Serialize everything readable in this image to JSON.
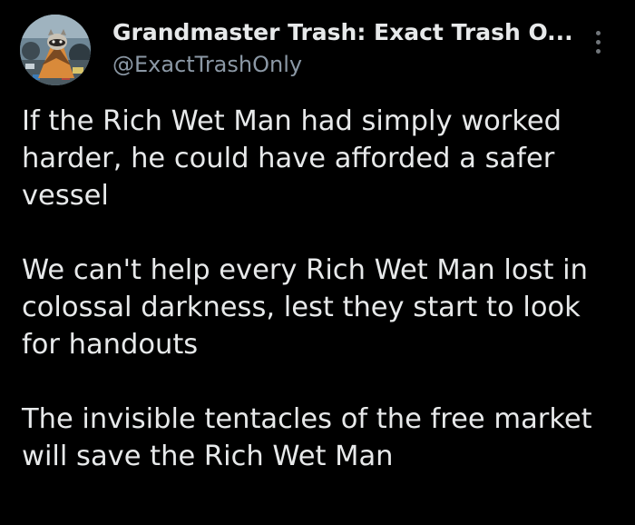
{
  "author": {
    "display_name": "Grandmaster Trash: Exact Trash O...",
    "handle": "@ExactTrashOnly",
    "avatar_icon": "raccoon-in-trash-avatar"
  },
  "menu": {
    "icon": "more-vertical-icon"
  },
  "tweet": {
    "paragraphs": [
      "If the Rich Wet Man had simply worked\nharder, he could have afforded a safer\nvessel",
      "We can't help every Rich Wet Man lost in\ncolossal darkness, lest they start to look\nfor handouts",
      "The invisible tentacles of the free market\nwill save the Rich Wet Man"
    ]
  },
  "colors": {
    "background": "#000000",
    "primary_text": "#e7e9ea",
    "secondary_text": "#8b98a5"
  }
}
